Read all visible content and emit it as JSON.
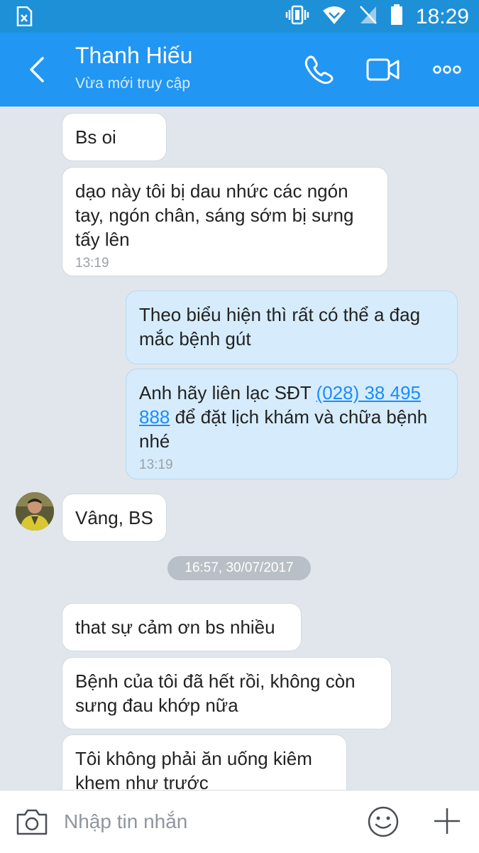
{
  "status_bar": {
    "time": "18:29"
  },
  "header": {
    "contact_name": "Thanh Hiếu",
    "status": "Vừa mới truy cập"
  },
  "messages": [
    {
      "text": "Bs oi"
    },
    {
      "text": "dạo này tôi bị dau nhức các ngón tay, ngón chân, sáng sớm bị sưng tấy lên",
      "time": "13:19"
    },
    {
      "text": "Theo biểu hiện thì rất có thể a đag mắc bệnh gút"
    },
    {
      "text_before": "Anh hãy liên lạc SĐT ",
      "phone": "(028) 38 495 888",
      "text_after": " để đặt lịch khám và chữa bệnh nhé",
      "time": "13:19"
    },
    {
      "text": "Vâng, BS"
    },
    {
      "text": "that sự cảm ơn bs nhiều"
    },
    {
      "text": "Bệnh của tôi đã hết rồi, không còn sưng đau khớp nữa"
    },
    {
      "text": "Tôi không phải ăn uống kiêm khem như trước"
    }
  ],
  "date_separator": "16:57, 30/07/2017",
  "composer": {
    "placeholder": "Nhập tin nhắn"
  },
  "icons": {
    "status": [
      "no-sim-notification-icon",
      "vibrate-icon",
      "wifi-icon",
      "no-signal-icon",
      "battery-icon"
    ],
    "header": [
      "back-icon",
      "phone-call-icon",
      "video-call-icon",
      "more-options-icon"
    ],
    "composer": [
      "camera-icon",
      "emoji-icon",
      "plus-icon"
    ]
  },
  "colors": {
    "header": "#2196f3",
    "status_bar": "#1e90d8",
    "outgoing_bubble": "#d6ecfc",
    "incoming_bubble": "#ffffff",
    "link": "#1a8cff",
    "background": "#e1e6ec"
  }
}
